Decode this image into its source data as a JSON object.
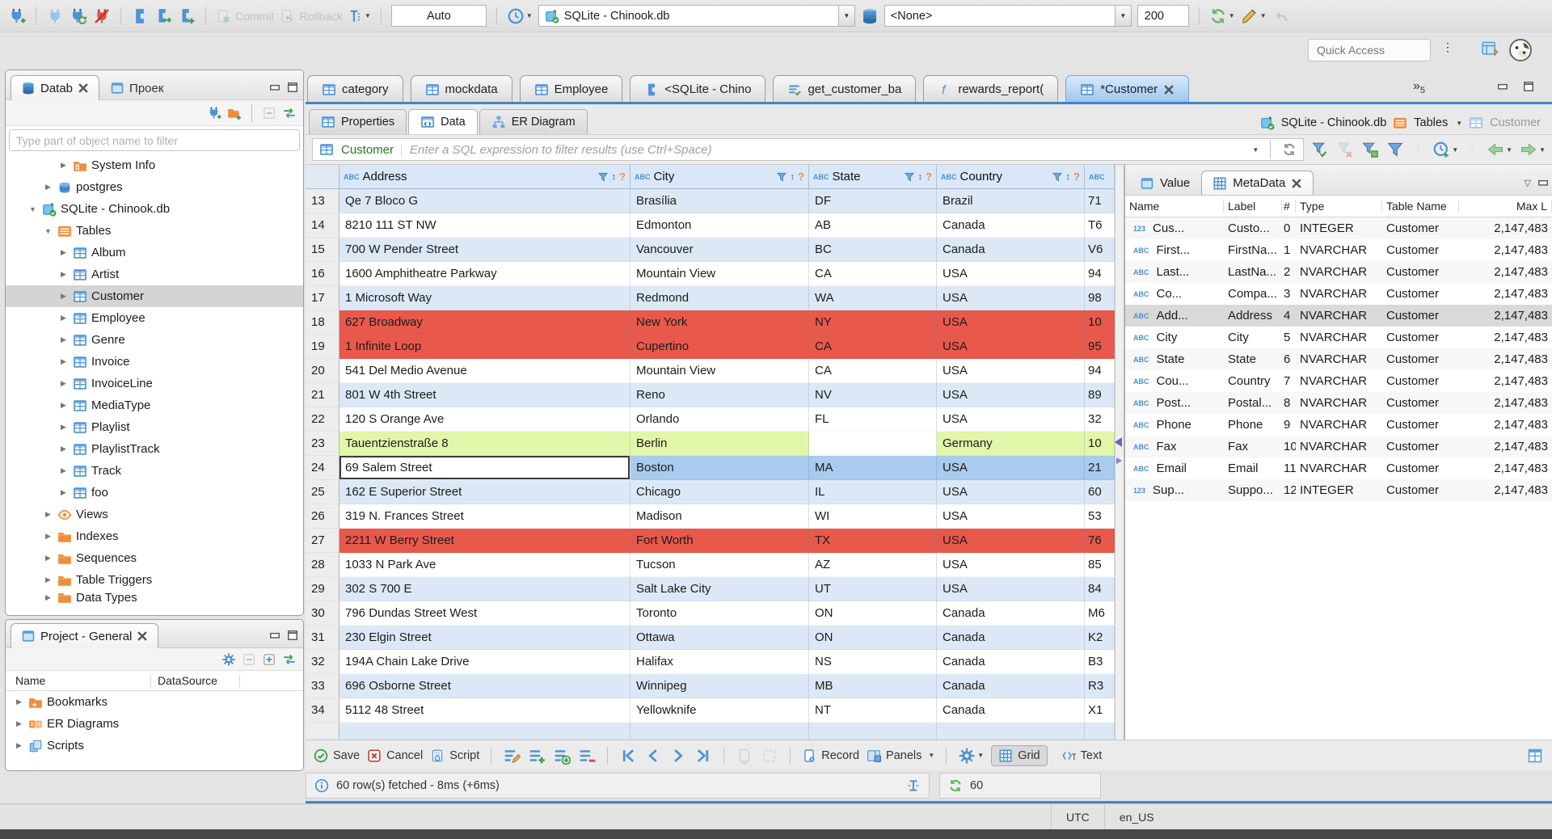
{
  "topbar": {
    "commit": "Commit",
    "rollback": "Rollback",
    "auto": "Auto",
    "connection": "SQLite - Chinook.db",
    "schema": "<None>",
    "fetch_size": "200",
    "quick_access": "Quick Access"
  },
  "navigator": {
    "tab_database": "Datab",
    "tab_projects": "Проек",
    "filter_placeholder": "Type part of object name to filter",
    "tree": [
      {
        "label": "System Info",
        "icon": "folderinfo",
        "indent": 3,
        "arrow": "▶"
      },
      {
        "label": "postgres",
        "icon": "db",
        "indent": 2,
        "arrow": "▶"
      },
      {
        "label": "SQLite - Chinook.db",
        "icon": "sqlite",
        "indent": 1,
        "arrow": "▼"
      },
      {
        "label": "Tables",
        "icon": "foldertable",
        "indent": 2,
        "arrow": "▼"
      },
      {
        "label": "Album",
        "icon": "table",
        "indent": 3,
        "arrow": "▶"
      },
      {
        "label": "Artist",
        "icon": "table",
        "indent": 3,
        "arrow": "▶"
      },
      {
        "label": "Customer",
        "icon": "table",
        "indent": 3,
        "arrow": "▶",
        "selected": true
      },
      {
        "label": "Employee",
        "icon": "table",
        "indent": 3,
        "arrow": "▶"
      },
      {
        "label": "Genre",
        "icon": "table",
        "indent": 3,
        "arrow": "▶"
      },
      {
        "label": "Invoice",
        "icon": "table",
        "indent": 3,
        "arrow": "▶"
      },
      {
        "label": "InvoiceLine",
        "icon": "table",
        "indent": 3,
        "arrow": "▶"
      },
      {
        "label": "MediaType",
        "icon": "table",
        "indent": 3,
        "arrow": "▶"
      },
      {
        "label": "Playlist",
        "icon": "table",
        "indent": 3,
        "arrow": "▶"
      },
      {
        "label": "PlaylistTrack",
        "icon": "table",
        "indent": 3,
        "arrow": "▶"
      },
      {
        "label": "Track",
        "icon": "table",
        "indent": 3,
        "arrow": "▶"
      },
      {
        "label": "foo",
        "icon": "table",
        "indent": 3,
        "arrow": "▶"
      },
      {
        "label": "Views",
        "icon": "eye",
        "indent": 2,
        "arrow": "▶"
      },
      {
        "label": "Indexes",
        "icon": "folder",
        "indent": 2,
        "arrow": "▶"
      },
      {
        "label": "Sequences",
        "icon": "folder",
        "indent": 2,
        "arrow": "▶"
      },
      {
        "label": "Table Triggers",
        "icon": "folder",
        "indent": 2,
        "arrow": "▶"
      },
      {
        "label": "Data Types",
        "icon": "folder",
        "indent": 2,
        "arrow": "▶",
        "clipped": true
      }
    ]
  },
  "project_panel": {
    "tab": "Project - General",
    "col_name": "Name",
    "col_datasource": "DataSource",
    "items": [
      {
        "label": "Bookmarks",
        "icon": "folderstar",
        "arrow": "▶"
      },
      {
        "label": "ER Diagrams",
        "icon": "er",
        "arrow": "▶"
      },
      {
        "label": "Scripts",
        "icon": "scripts",
        "arrow": "▶"
      }
    ]
  },
  "editor": {
    "tabs": [
      {
        "label": "category",
        "icon": "table"
      },
      {
        "label": "mockdata",
        "icon": "table"
      },
      {
        "label": "Employee",
        "icon": "table"
      },
      {
        "label": "<SQLite - Chino",
        "icon": "sqled"
      },
      {
        "label": "get_customer_ba",
        "icon": "sqlcheck"
      },
      {
        "label": "rewards_report(",
        "icon": "func"
      },
      {
        "label": "*Customer",
        "icon": "table",
        "active": true,
        "closable": true
      }
    ],
    "overflow_glyph": "»",
    "overflow_count": "5",
    "subtabs": [
      {
        "label": "Properties",
        "icon": "table"
      },
      {
        "label": "Data",
        "icon": "tabledata",
        "active": true
      },
      {
        "label": "ER Diagram",
        "icon": "erdiag"
      }
    ],
    "breadcrumb": {
      "connection": "SQLite - Chinook.db",
      "container": "Tables",
      "entity": "Customer"
    },
    "filter_entity": "Customer",
    "filter_placeholder": "Enter a SQL expression to filter results (use Ctrl+Space)"
  },
  "grid": {
    "headers": [
      {
        "label": "Address",
        "controls": true
      },
      {
        "label": "City",
        "controls": true
      },
      {
        "label": "State",
        "controls": true
      },
      {
        "label": "Country",
        "controls": true
      },
      {
        "label": "",
        "controls": false
      }
    ],
    "rows": [
      {
        "num": 13,
        "address": "Qe 7 Bloco G",
        "city": "Brasília",
        "state": "DF",
        "country": "Brazil",
        "postal": "71"
      },
      {
        "num": 14,
        "address": "8210 111 ST NW",
        "city": "Edmonton",
        "state": "AB",
        "country": "Canada",
        "postal": "T6"
      },
      {
        "num": 15,
        "address": "700 W Pender Street",
        "city": "Vancouver",
        "state": "BC",
        "country": "Canada",
        "postal": "V6"
      },
      {
        "num": 16,
        "address": "1600 Amphitheatre Parkway",
        "city": "Mountain View",
        "state": "CA",
        "country": "USA",
        "postal": "94"
      },
      {
        "num": 17,
        "address": "1 Microsoft Way",
        "city": "Redmond",
        "state": "WA",
        "country": "USA",
        "postal": "98"
      },
      {
        "num": 18,
        "address": "627 Broadway",
        "city": "New York",
        "state": "NY",
        "country": "USA",
        "postal": "10",
        "rowstate": "deleted"
      },
      {
        "num": 19,
        "address": "1 Infinite Loop",
        "city": "Cupertino",
        "state": "CA",
        "country": "USA",
        "postal": "95",
        "rowstate": "deleted"
      },
      {
        "num": 20,
        "address": "541 Del Medio Avenue",
        "city": "Mountain View",
        "state": "CA",
        "country": "USA",
        "postal": "94"
      },
      {
        "num": 21,
        "address": "801 W 4th Street",
        "city": "Reno",
        "state": "NV",
        "country": "USA",
        "postal": "89"
      },
      {
        "num": 22,
        "address": "120 S Orange Ave",
        "city": "Orlando",
        "state": "FL",
        "country": "USA",
        "postal": "32"
      },
      {
        "num": 23,
        "address": "Tauentzienstraße 8",
        "city": "Berlin",
        "state": "",
        "country": "Germany",
        "postal": "10",
        "rowstate": "modified"
      },
      {
        "num": 24,
        "address": "69 Salem Street",
        "city": "Boston",
        "state": "MA",
        "country": "USA",
        "postal": "21",
        "rowstate": "selected"
      },
      {
        "num": 25,
        "address": "162 E Superior Street",
        "city": "Chicago",
        "state": "IL",
        "country": "USA",
        "postal": "60"
      },
      {
        "num": 26,
        "address": "319 N. Frances Street",
        "city": "Madison",
        "state": "WI",
        "country": "USA",
        "postal": "53"
      },
      {
        "num": 27,
        "address": "2211 W Berry Street",
        "city": "Fort Worth",
        "state": "TX",
        "country": "USA",
        "postal": "76",
        "rowstate": "deleted"
      },
      {
        "num": 28,
        "address": "1033 N Park Ave",
        "city": "Tucson",
        "state": "AZ",
        "country": "USA",
        "postal": "85"
      },
      {
        "num": 29,
        "address": "302 S 700 E",
        "city": "Salt Lake City",
        "state": "UT",
        "country": "USA",
        "postal": "84"
      },
      {
        "num": 30,
        "address": "796 Dundas Street West",
        "city": "Toronto",
        "state": "ON",
        "country": "Canada",
        "postal": "M6"
      },
      {
        "num": 31,
        "address": "230 Elgin Street",
        "city": "Ottawa",
        "state": "ON",
        "country": "Canada",
        "postal": "K2"
      },
      {
        "num": 32,
        "address": "194A Chain Lake Drive",
        "city": "Halifax",
        "state": "NS",
        "country": "Canada",
        "postal": "B3"
      },
      {
        "num": 33,
        "address": "696 Osborne Street",
        "city": "Winnipeg",
        "state": "MB",
        "country": "Canada",
        "postal": "R3"
      },
      {
        "num": 34,
        "address": "5112 48 Street",
        "city": "Yellowknife",
        "state": "NT",
        "country": "Canada",
        "postal": "X1"
      }
    ]
  },
  "metadata": {
    "tab_value": "Value",
    "tab_metadata": "MetaData",
    "headers": [
      "Name",
      "Label",
      "#",
      "Type",
      "Table Name",
      "Max L"
    ],
    "rows": [
      {
        "icon": "t123",
        "name": "Cus...",
        "label": "Custo...",
        "num": "0",
        "type": "INTEGER",
        "table": "Customer",
        "max": "2,147,483"
      },
      {
        "icon": "tabc",
        "name": "First...",
        "label": "FirstNa...",
        "num": "1",
        "type": "NVARCHAR",
        "table": "Customer",
        "max": "2,147,483"
      },
      {
        "icon": "tabc",
        "name": "Last...",
        "label": "LastNa...",
        "num": "2",
        "type": "NVARCHAR",
        "table": "Customer",
        "max": "2,147,483"
      },
      {
        "icon": "tabc",
        "name": "Co...",
        "label": "Compa...",
        "num": "3",
        "type": "NVARCHAR",
        "table": "Customer",
        "max": "2,147,483"
      },
      {
        "icon": "tabc",
        "name": "Add...",
        "label": "Address",
        "num": "4",
        "type": "NVARCHAR",
        "table": "Customer",
        "max": "2,147,483",
        "selected": true
      },
      {
        "icon": "tabc",
        "name": "City",
        "label": "City",
        "num": "5",
        "type": "NVARCHAR",
        "table": "Customer",
        "max": "2,147,483"
      },
      {
        "icon": "tabc",
        "name": "State",
        "label": "State",
        "num": "6",
        "type": "NVARCHAR",
        "table": "Customer",
        "max": "2,147,483"
      },
      {
        "icon": "tabc",
        "name": "Cou...",
        "label": "Country",
        "num": "7",
        "type": "NVARCHAR",
        "table": "Customer",
        "max": "2,147,483"
      },
      {
        "icon": "tabc",
        "name": "Post...",
        "label": "Postal...",
        "num": "8",
        "type": "NVARCHAR",
        "table": "Customer",
        "max": "2,147,483"
      },
      {
        "icon": "tabc",
        "name": "Phone",
        "label": "Phone",
        "num": "9",
        "type": "NVARCHAR",
        "table": "Customer",
        "max": "2,147,483"
      },
      {
        "icon": "tabc",
        "name": "Fax",
        "label": "Fax",
        "num": "10",
        "type": "NVARCHAR",
        "table": "Customer",
        "max": "2,147,483"
      },
      {
        "icon": "tabc",
        "name": "Email",
        "label": "Email",
        "num": "11",
        "type": "NVARCHAR",
        "table": "Customer",
        "max": "2,147,483"
      },
      {
        "icon": "t123",
        "name": "Sup...",
        "label": "Suppo...",
        "num": "12",
        "type": "INTEGER",
        "table": "Customer",
        "max": "2,147,483"
      }
    ]
  },
  "footer": {
    "save": "Save",
    "cancel": "Cancel",
    "script": "Script",
    "record": "Record",
    "panels": "Panels",
    "grid": "Grid",
    "text": "Text",
    "status": "60 row(s) fetched - 8ms (+6ms)",
    "fetch_count": "60"
  },
  "statusbar": {
    "timezone": "UTC",
    "locale": "en_US"
  }
}
